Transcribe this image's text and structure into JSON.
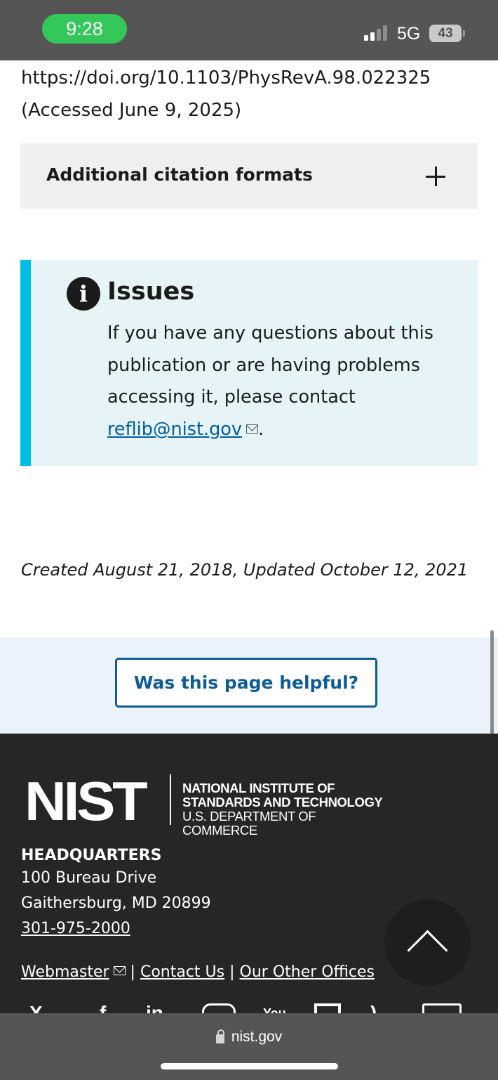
{
  "status_bar": {
    "time": "9:28",
    "network": "5G",
    "battery": "43"
  },
  "citation": {
    "doi_url": "https://doi.org/10.1103/PhysRevA.98.022325",
    "accessed": "(Accessed June 9, 2025)"
  },
  "accordion": {
    "title": "Additional citation formats",
    "icon": "plus-icon"
  },
  "issues": {
    "icon": "info-icon",
    "heading": "Issues",
    "body_text": "If you have any questions about this publication or are having problems accessing it, please contact ",
    "email": "reflib@nist.gov",
    "period": "."
  },
  "page_dates": "Created August 21, 2018, Updated October 12, 2021",
  "feedback": {
    "button_label": "Was this page helpful?"
  },
  "footer": {
    "logo": {
      "wordmark": "NIST",
      "line1": "NATIONAL INSTITUTE OF",
      "line2": "STANDARDS AND TECHNOLOGY",
      "line3": "U.S. DEPARTMENT OF COMMERCE"
    },
    "hq_title": "HEADQUARTERS",
    "address_line1": "100 Bureau Drive",
    "address_line2": "Gaithersburg, MD 20899",
    "phone": "301-975-2000",
    "links": {
      "webmaster": "Webmaster",
      "contact": "Contact Us",
      "offices": "Our Other Offices",
      "separator": "|"
    },
    "social_icons": [
      "x-icon",
      "facebook-icon",
      "linkedin-icon",
      "instagram-icon",
      "youtube-icon",
      "giphy-icon",
      "rss-icon",
      "email-icon"
    ]
  },
  "browser": {
    "url": "nist.gov"
  },
  "colors": {
    "alert_accent": "#00bde3",
    "link": "#005ea2",
    "button": "#0d5c95",
    "footer_bg": "#262626",
    "status_green": "#34c759"
  }
}
